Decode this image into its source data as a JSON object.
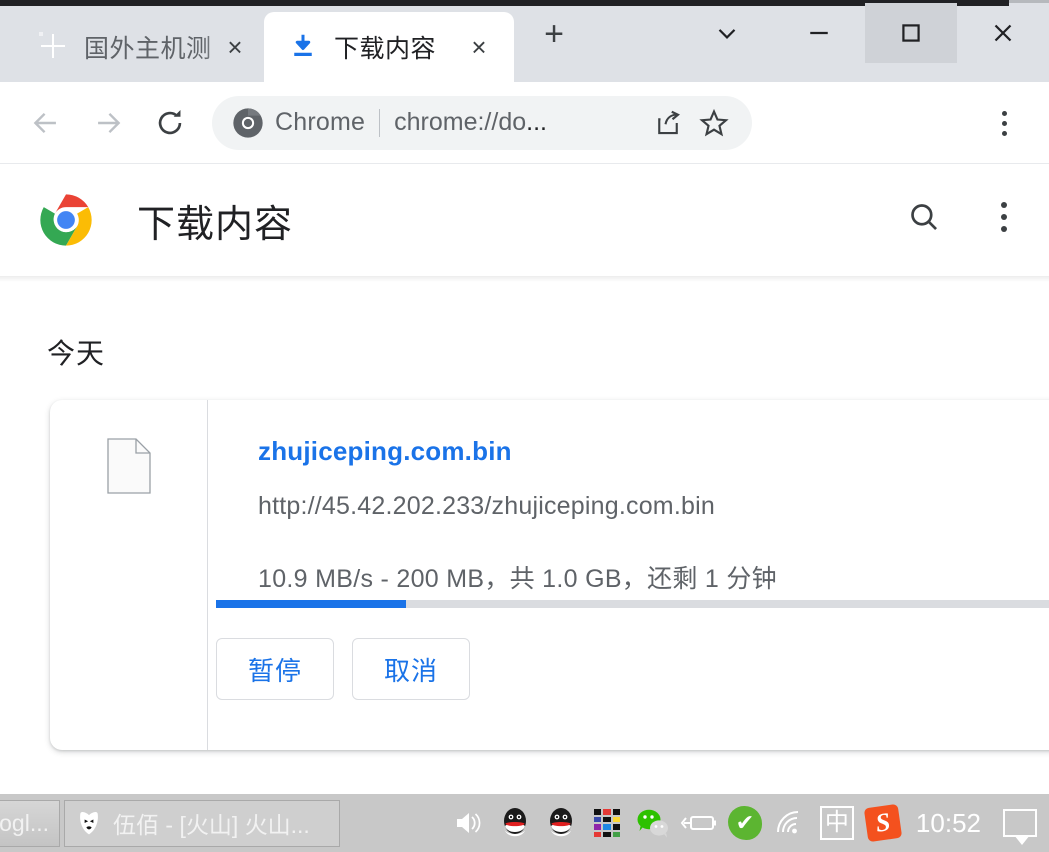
{
  "window": {
    "controls": {
      "tab_search": "chevron-down-icon",
      "minimize": "minimize-icon",
      "maximize": "maximize-icon",
      "close": "close-icon"
    }
  },
  "tabs": [
    {
      "title": "国外主机测",
      "favicon": "red-seal-favicon",
      "active": false,
      "close_label": "×"
    },
    {
      "title": "下载内容",
      "favicon": "download-arrow-icon",
      "active": true,
      "close_label": "×"
    }
  ],
  "newtab_label": "+",
  "toolbar": {
    "back_icon": "back-arrow-icon",
    "forward_icon": "forward-arrow-icon",
    "reload_icon": "reload-icon",
    "omnibox": {
      "brand": "Chrome",
      "url_visible": "chrome://do",
      "url_truncation": "...",
      "share_icon": "share-icon",
      "bookmark_icon": "star-icon"
    },
    "menu_icon": "three-dots-vertical-icon"
  },
  "page": {
    "logo": "chrome-logo",
    "title": "下载内容",
    "search_icon": "search-icon",
    "menu_icon": "three-dots-vertical-icon",
    "watermark": "zhujiceping.com",
    "section_label": "今天",
    "download": {
      "file_icon": "generic-file-icon",
      "filename": "zhujiceping.com.bin",
      "url": "http://45.42.202.233/zhujiceping.com.bin",
      "status": "10.9 MB/s - 200 MB，共 1.0 GB，还剩 1 分钟",
      "speed": "10.9 MB/s",
      "downloaded": "200 MB",
      "total": "1.0 GB",
      "time_left": "还剩 1 分钟",
      "progress_percent": 19,
      "progress_color": "#1a73e8",
      "pause_label": "暂停",
      "cancel_label": "取消"
    }
  },
  "taskbar": {
    "windows": [
      {
        "label": "ogl...",
        "icon": "window-partial"
      },
      {
        "label": "伍佰 - [火山] 火山...",
        "icon": "foobar2000-icon"
      }
    ],
    "tray": [
      {
        "name": "volume-icon",
        "glyph": "🔊"
      },
      {
        "name": "qq-icon-1",
        "glyph": ""
      },
      {
        "name": "qq-icon-2",
        "glyph": ""
      },
      {
        "name": "color-grid-icon",
        "glyph": ""
      },
      {
        "name": "wechat-icon",
        "glyph": ""
      },
      {
        "name": "battery-charging-icon",
        "glyph": ""
      },
      {
        "name": "green-check-icon",
        "glyph": "✔"
      },
      {
        "name": "wifi-icon",
        "glyph": ""
      },
      {
        "name": "ime-chinese-icon",
        "glyph": "中"
      },
      {
        "name": "sogou-icon",
        "glyph": "S"
      }
    ],
    "clock": "10:52",
    "notification_icon": "notification-balloon-icon"
  }
}
